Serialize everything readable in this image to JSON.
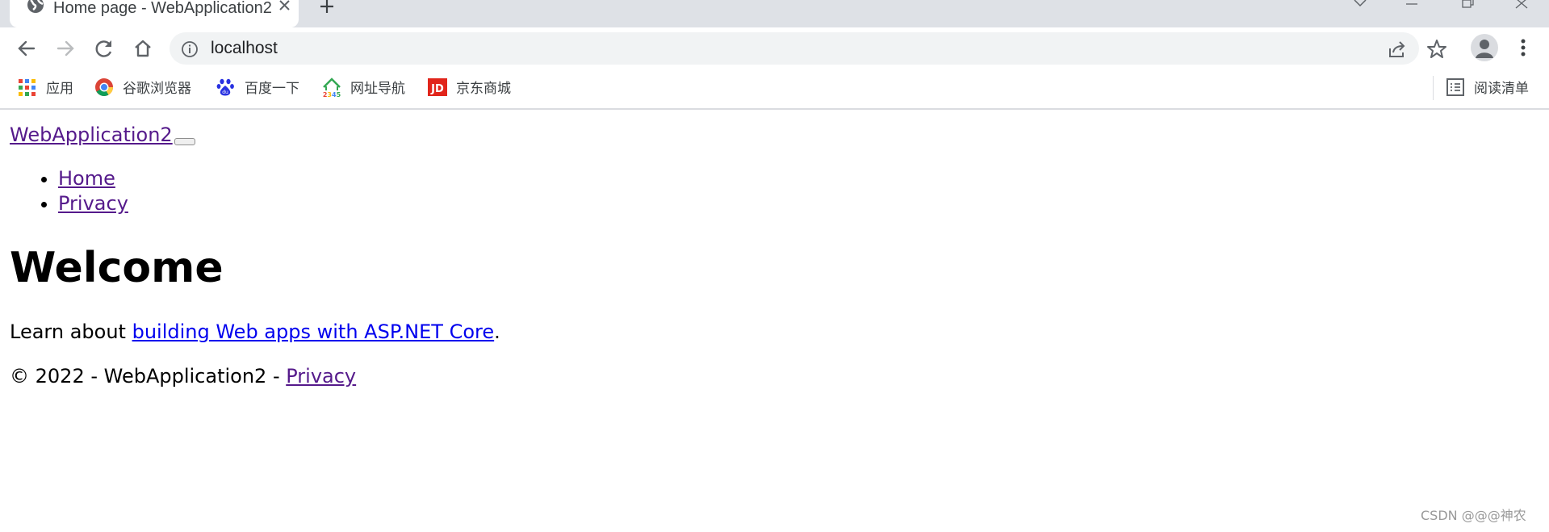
{
  "browser": {
    "tab": {
      "title": "Home page - WebApplication2",
      "globe_icon": "globe-icon",
      "close_icon": "close-icon"
    },
    "new_tab_icon": "plus-icon",
    "window_controls": [
      "chevron-down-icon",
      "minimize-icon",
      "restore-icon",
      "close-icon"
    ],
    "toolbar": {
      "back_icon": "back-arrow-icon",
      "forward_icon": "forward-arrow-icon",
      "reload_icon": "reload-icon",
      "home_icon": "home-icon",
      "address": "localhost",
      "info_icon": "info-icon",
      "share_icon": "share-icon",
      "bookmark_icon": "star-icon",
      "profile_icon": "profile-icon",
      "menu_icon": "more-vertical-icon"
    },
    "bookmarks": [
      {
        "label": "应用",
        "icon": "apps-grid-icon"
      },
      {
        "label": "谷歌浏览器",
        "icon": "chrome-icon"
      },
      {
        "label": "百度一下",
        "icon": "baidu-paw-icon"
      },
      {
        "label": "网址导航",
        "icon": "2345-nav-icon"
      },
      {
        "label": "京东商城",
        "icon": "jd-icon",
        "icon_text": "JD"
      }
    ],
    "reading_list": {
      "label": "阅读清单",
      "icon": "reading-list-icon"
    }
  },
  "page": {
    "brand": "WebApplication2",
    "nav": [
      "Home",
      "Privacy"
    ],
    "heading": "Welcome",
    "learn_prefix": "Learn about ",
    "learn_link": "building Web apps with ASP.NET Core",
    "learn_suffix": ".",
    "footer_prefix": "© 2022 - WebApplication2 - ",
    "footer_link": "Privacy"
  },
  "watermark": "CSDN @@@神农",
  "colors": {
    "tabstrip_bg": "#dee1e6",
    "omnibox_bg": "#f1f3f4",
    "visited_link": "#551a8b",
    "unvisited_link": "#0000ee",
    "watermark": "#999999"
  }
}
